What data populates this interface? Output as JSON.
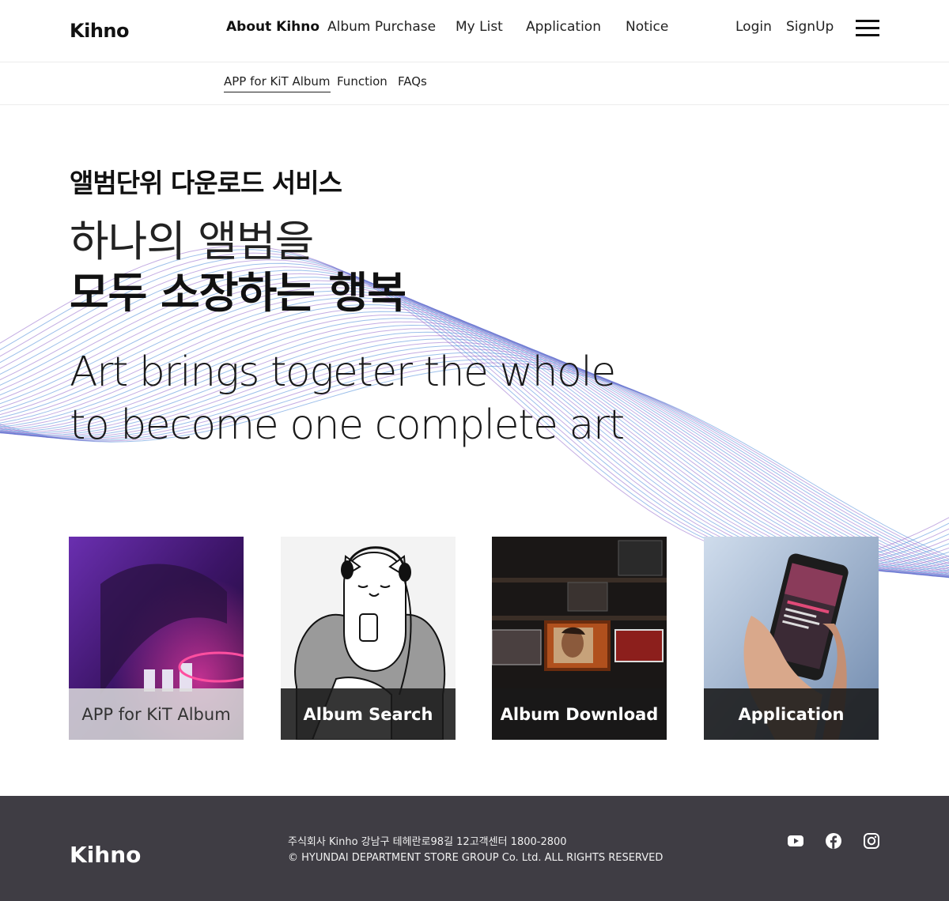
{
  "header": {
    "logo": "Kihno",
    "nav": [
      "About Kihno",
      "Album Purchase",
      "My List",
      "Application",
      "Notice"
    ],
    "login": "Login",
    "signup": "SignUp",
    "menu_icon": "hamburger-menu-icon"
  },
  "subnav": {
    "items": [
      "APP for KiT Album",
      "Function",
      "FAQs"
    ]
  },
  "hero": {
    "kicker": "앨범단위 다운로드 서비스",
    "title_line1": "하나의 앨범을",
    "title_line2": "모두 소장하는 행복",
    "english_line1": "Art brings togeter the whole",
    "english_line2": "to become one complete art"
  },
  "cards": [
    {
      "label": "APP for KiT Album",
      "image": "dj-turntable-photo"
    },
    {
      "label": "Album Search",
      "image": "cat-with-headphones-illustration"
    },
    {
      "label": "Album Download",
      "image": "record-shelf-photo"
    },
    {
      "label": "Application",
      "image": "phone-music-app-photo"
    }
  ],
  "footer": {
    "logo": "Kihno",
    "info_line1": "주식회사 Kinho  강남구 테헤란로98길 12고객센터 1800-2800",
    "info_line2": "© HYUNDAI DEPARTMENT STORE GROUP Co. Ltd. ALL RIGHTS RESERVED",
    "social": [
      "youtube-icon",
      "facebook-icon",
      "instagram-icon"
    ]
  },
  "colors": {
    "wave_blue": "#3a7fd5",
    "wave_purple": "#8a5cc8",
    "footer_bg": "#3f3d44"
  }
}
